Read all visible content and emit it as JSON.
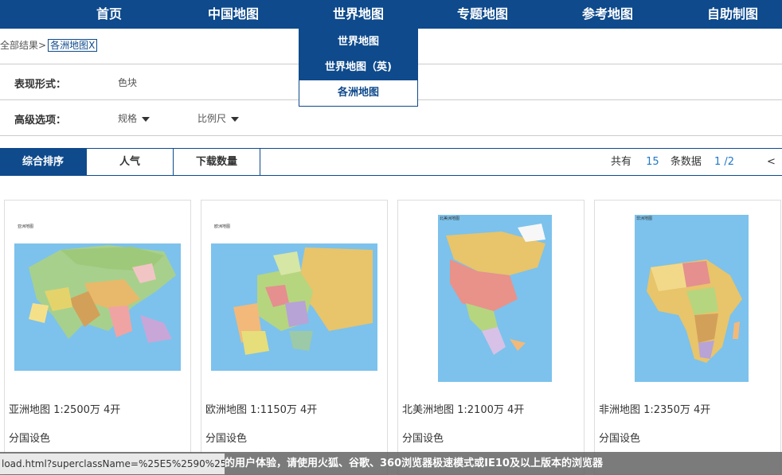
{
  "nav": {
    "items": [
      "首页",
      "中国地图",
      "世界地图",
      "专题地图",
      "参考地图",
      "自助制图"
    ]
  },
  "dropdown": {
    "items": [
      "世界地图",
      "世界地图（英)",
      "各洲地图"
    ]
  },
  "breadcrumb": {
    "root": "全部结果>",
    "tag": "各洲地图X"
  },
  "filters": {
    "form_label": "表现形式：",
    "form_value": "色块",
    "advanced_label": "高级选项：",
    "spec_label": "规格",
    "scale_label": "比例尺"
  },
  "sort": {
    "tabs": [
      "综合排序",
      "人气",
      "下载数量"
    ],
    "total_prefix": "共有",
    "total": "15",
    "total_suffix": "条数据",
    "page": "1 /2",
    "prev": "<"
  },
  "cards": [
    {
      "title": "亚洲地图 1:2500万 4开",
      "sub": "分国设色"
    },
    {
      "title": "欧洲地图 1:1150万 4开",
      "sub": "分国设色"
    },
    {
      "title": "北美洲地图 1:2100万 4开",
      "sub": "分国设色"
    },
    {
      "title": "非洲地图 1:2350万 4开",
      "sub": "分国设色"
    }
  ],
  "statusbar": {
    "url": "load.html?superclassName=%25E5%2590%25...",
    "message": "的用户体验，请使用火狐、谷歌、360浏览器极速模式或IE10及以上版本的浏览器"
  },
  "colors": {
    "primary": "#0e4a8c",
    "link": "#1f78c8",
    "ocean": "#7cc2ec"
  }
}
